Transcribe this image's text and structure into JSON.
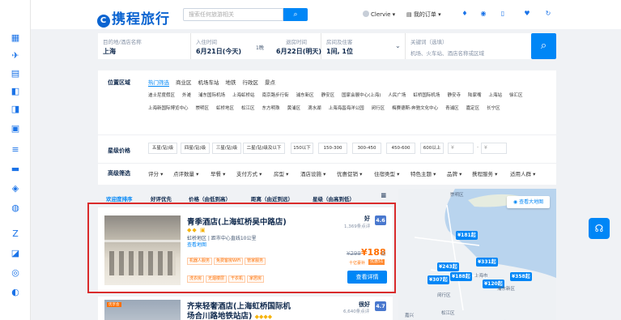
{
  "sidebar": {
    "items": [
      {
        "name": "sidebar-item-hotel",
        "icon": "building-icon",
        "glyph": "▦"
      },
      {
        "name": "sidebar-item-flight",
        "icon": "plane-icon",
        "glyph": "✈"
      },
      {
        "name": "sidebar-item-train",
        "icon": "train-icon",
        "glyph": "▤"
      },
      {
        "name": "sidebar-item-trip",
        "icon": "suitcase-icon",
        "glyph": "◧"
      },
      {
        "name": "sidebar-item-ticket",
        "icon": "ticket-icon",
        "glyph": "◨"
      },
      {
        "name": "sidebar-item-bus",
        "icon": "bus-icon",
        "glyph": "▣"
      },
      {
        "name": "sidebar-item-more",
        "icon": "menu-icon",
        "glyph": "≡"
      },
      {
        "name": "sidebar-item-car",
        "icon": "car-icon",
        "glyph": "▬"
      },
      {
        "name": "sidebar-item-deal",
        "icon": "tag-icon",
        "glyph": "◈"
      },
      {
        "name": "sidebar-item-globe",
        "icon": "globe-icon",
        "glyph": "◍"
      },
      {
        "name": "sidebar-item-z",
        "icon": "z-icon",
        "glyph": "Z"
      },
      {
        "name": "sidebar-item-gift",
        "icon": "gift-icon",
        "glyph": "◪"
      },
      {
        "name": "sidebar-item-route",
        "icon": "route-icon",
        "glyph": "◎"
      },
      {
        "name": "sidebar-item-explore",
        "icon": "compass-icon",
        "glyph": "◐"
      }
    ]
  },
  "header": {
    "logo": "携程旅行",
    "search_placeholder": "搜索任何旅游相关",
    "user": "Clervie",
    "orders": "我的订单"
  },
  "search": {
    "dest_label": "目的地/酒店名称",
    "dest_value": "上海",
    "checkin_label": "入住时间",
    "checkin_value": "6月21日(今天)",
    "nights": "1晚",
    "checkout_label": "退房时间",
    "checkout_value": "6月22日(明天)",
    "rooms_label": "房间及住客",
    "rooms_value": "1间, 1位",
    "kw_label": "关键词（选填）",
    "kw_placeholder": "机场、火车站、酒店名称或区域"
  },
  "filters": {
    "location_label": "位置区域",
    "tabs": [
      "热门筛选",
      "商业区",
      "机场车站",
      "地铁",
      "行政区",
      "景点"
    ],
    "locations": [
      "迪士尼度假区",
      "外滩",
      "浦东国际机场",
      "上海虹桥站",
      "南京路步行街",
      "浦东新区",
      "静安区",
      "国家会展中心(上海)",
      "人民广场",
      "虹桥国际机场",
      "静安寺",
      "陆家嘴",
      "上海站",
      "徐汇区",
      "上海新国际博览中心",
      "崇明区",
      "虹桥地区",
      "松江区",
      "东方明珠",
      "黄浦区",
      "滴水湖",
      "上海海昌海洋公园",
      "闵行区",
      "梅赛德斯-奔驰文化中心",
      "青浦区",
      "嘉定区",
      "长宁区"
    ],
    "star_label": "星级价格",
    "stars": [
      "五星(钻)级",
      "四星(钻)级",
      "三星(钻)级",
      "二星(钻)级及以下"
    ],
    "prices": [
      "150以下",
      "150-300",
      "300-450",
      "450-600",
      "600以上"
    ],
    "price_min": "¥",
    "price_sep": "-",
    "price_max": "¥",
    "adv_label": "高级筛选",
    "advanced": [
      "评分 ▾",
      "点评数量 ▾",
      "早餐 ▾",
      "支付方式 ▾",
      "房型 ▾",
      "酒店设施 ▾",
      "优惠促销 ▾",
      "住宿类型 ▾",
      "特色主题 ▾",
      "品牌 ▾",
      "携程服务 ▾",
      "适用人群 ▾"
    ]
  },
  "sort": {
    "items": [
      "欢迎度排序",
      "好评优先",
      "价格（由低到高）",
      "距离（由近到远）",
      "星级（由高到低）"
    ],
    "list_icon": "≡"
  },
  "hotels": [
    {
      "name": "青季酒店(上海虹桥吴中路店)",
      "diamonds": "◆◆ ▣",
      "location": "虹桥地区 | 距市中心直线10公里",
      "map_link": "查看地图",
      "tags": [
        "机器人服务",
        "免费客房WiFi",
        "管家服务",
        "洗衣房",
        "无烟楼层",
        "干衣机",
        "家居房"
      ],
      "rating_label": "好",
      "score": "4.6",
      "reviews": "1,369条点评",
      "old_price": "¥299",
      "price": "¥188",
      "price_suffix": "起",
      "promo1": "十亿豪补",
      "promo2": "优惠51",
      "button": "查看详情"
    },
    {
      "name_line1": "齐来轻奢酒店(上海虹桥国际机",
      "name_line2": "场合川路地铁站店)",
      "diamonds": "◆◆◆◆",
      "rating_label": "很好",
      "score": "4.7",
      "reviews": "6,640条点评",
      "badge": "优享会"
    }
  ],
  "map": {
    "button": "查看大地图",
    "pins": [
      "¥181起",
      "¥331起",
      "¥243起",
      "¥188起",
      "¥307起",
      "¥120起",
      "¥358起"
    ],
    "labels": [
      "崇明区",
      "闵行区",
      "浦东新区",
      "上海市",
      "嘉兴",
      "松江区"
    ]
  },
  "colors": {
    "primary": "#0086f6",
    "accent": "#ff6f00",
    "highlight": "#d92b2b"
  }
}
